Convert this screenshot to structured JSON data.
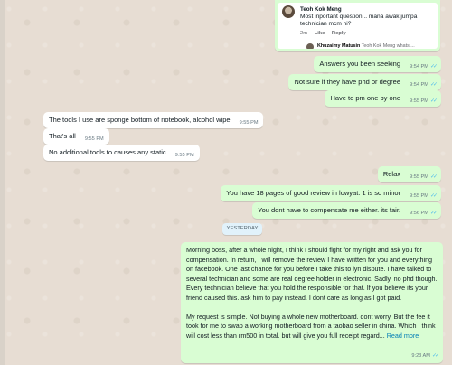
{
  "comment_card": {
    "author": "Teoh Kok Meng",
    "body": "Most inportant question... mana awak jumpa technician mcm ni?",
    "age": "2m",
    "like": "Like",
    "reply": "Reply",
    "reply_author": "Khuzaimy Matusin",
    "reply_preview": "Teoh Kok Meng whats ..."
  },
  "messages_top": [
    {
      "text": "Answers you been seeking",
      "time": "9:54 PM"
    },
    {
      "text": "Not sure if they have phd or degree",
      "time": "9:54 PM"
    },
    {
      "text": "Have to pm one by one",
      "time": "9:55 PM"
    }
  ],
  "messages_in": [
    {
      "text": "The tools I use are sponge bottom of notebook, alcohol wipe",
      "time": "9:55 PM"
    },
    {
      "text": "That's all",
      "time": "9:55 PM"
    },
    {
      "text": "No additional tools to causes any static",
      "time": "9:55 PM"
    }
  ],
  "messages_mid": [
    {
      "text": "Relax",
      "time": "9:55 PM"
    },
    {
      "text": "You have 18 pages of good review in lowyat. 1 is so minor",
      "time": "9:55 PM"
    },
    {
      "text": "You dont have to compensate me either. its fair.",
      "time": "9:56 PM"
    }
  ],
  "date_divider": "YESTERDAY",
  "long_message": {
    "para1": "Morning boss, after a whole night, I think I should fight for my right and ask you for compensation. In return, I will remove the review I have written for you and everything on facebook. One last chance for you before I take this to lyn dispute. I have talked to several technician and some are real degree holder in electronic. Sadly, no phd though. Every technician believe that you hold the responsible for that. If you believe its your friend caused this. ask him to pay instead. I dont care as long as I got paid.",
    "para2": "My request is simple. Not buying a whole new motherboard. dont worry. But the fee it took for me to swap a working motherboard from a taobao seller in china. Which I think will cost less than rm500 in total. but will give you full receipt regard...",
    "read_more": "Read more",
    "time": "9:23 AM"
  },
  "colors": {
    "outgoing": "#d9fdd3",
    "incoming": "#ffffff",
    "read_tick": "#53bdeb",
    "link": "#027eb5"
  }
}
